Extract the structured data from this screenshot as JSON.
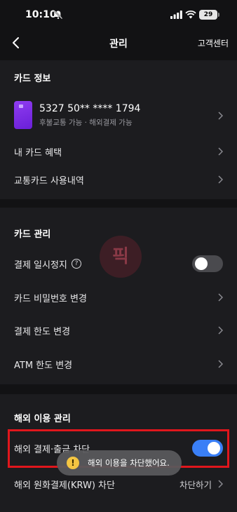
{
  "status_bar": {
    "time": "10:10",
    "battery": "29"
  },
  "nav": {
    "title": "관리",
    "support_label": "고객센터"
  },
  "card_info": {
    "title": "카드 정보",
    "card_number": "5327 50** **** 1794",
    "card_features": "후불교통 가능 · 해외결제 가능",
    "items": [
      {
        "label": "내 카드 혜택"
      },
      {
        "label": "교통카드 사용내역"
      }
    ]
  },
  "card_management": {
    "title": "카드 관리",
    "pause_label": "결제 일시정지",
    "pause_enabled": false,
    "items": [
      {
        "label": "카드 비밀번호 변경"
      },
      {
        "label": "결제 한도 변경"
      },
      {
        "label": "ATM 한도 변경"
      }
    ]
  },
  "overseas": {
    "title": "해외 이용 관리",
    "block_label": "해외 결제·출금 차단",
    "block_enabled": true,
    "krw_label": "해외 원화결제(KRW) 차단",
    "krw_value": "차단하기"
  },
  "toast": {
    "message": "해외 이용을 차단했어요."
  },
  "watermark": {
    "text": "픽"
  },
  "colors": {
    "accent": "#3a7ff6",
    "highlight": "#e0161c",
    "card": "#7a2ce6"
  }
}
